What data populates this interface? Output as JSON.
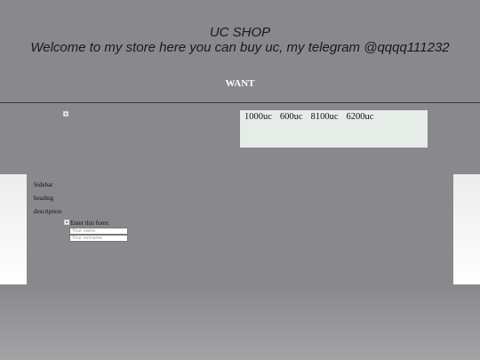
{
  "header": {
    "title": "UC SHOP",
    "tagline": "Welcome to my store here you can buy uc, my telegram @qqqq111232"
  },
  "nav": {
    "want_label": "WANT"
  },
  "prices": {
    "items": [
      "1000uc",
      "600uc",
      "8100uc",
      "6200uc"
    ]
  },
  "sidebar": {
    "title": "Sidebar",
    "heading": "heading",
    "description": "description"
  },
  "form": {
    "label": "Enter this form:",
    "name_placeholder": "Your name",
    "surname_placeholder": "Your surname"
  }
}
